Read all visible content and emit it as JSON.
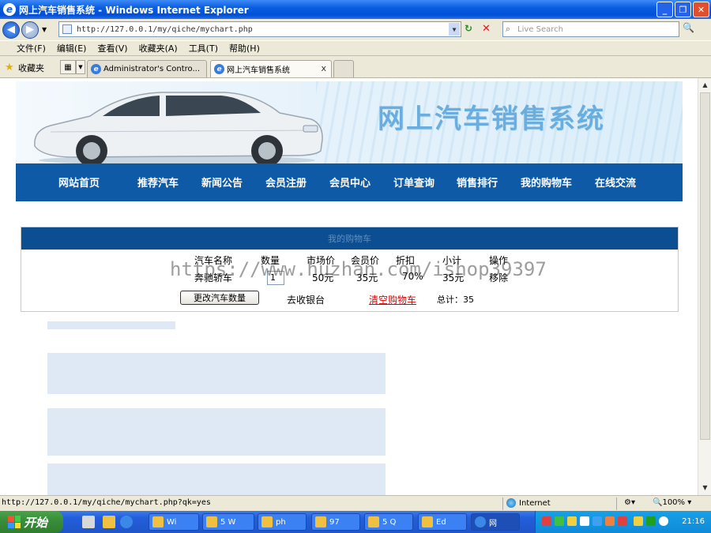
{
  "window": {
    "title": "网上汽车销售系统 - Windows Internet Explorer",
    "minimize": "_",
    "maximize": "❐",
    "close": "✕"
  },
  "addressbar": {
    "url": "http://127.0.0.1/my/qiche/mychart.php",
    "search_placeholder": "Live Search"
  },
  "menu": [
    "文件(F)",
    "编辑(E)",
    "查看(V)",
    "收藏夹(A)",
    "工具(T)",
    "帮助(H)"
  ],
  "favbar": {
    "favorites_label": "收藏夹",
    "tabs": [
      {
        "label": "Administrator's Contro..."
      },
      {
        "label": "网上汽车销售系统",
        "close": "x"
      }
    ]
  },
  "site": {
    "banner_title": "网上汽车销售系统",
    "nav": [
      "网站首页",
      "推荐汽车",
      "新闻公告",
      "会员注册",
      "会员中心",
      "订单查询",
      "销售排行",
      "我的购物车",
      "在线交流"
    ],
    "cart": {
      "header": "我的购物车",
      "columns": [
        "汽车名称",
        "数量",
        "市场价",
        "会员价",
        "折扣",
        "小计",
        "操作"
      ],
      "rows": [
        {
          "name": "奔驰轿车",
          "qty": "1",
          "market_price": "50元",
          "member_price": "35元",
          "discount": "70%",
          "subtotal": "35元",
          "action": "移除"
        }
      ],
      "update_button": "更改汽车数量",
      "checkout_link": "去收银台",
      "clear_link": "清空购物车",
      "total": "总计：35"
    }
  },
  "watermark": "https://www.huzhan.com/ishop39397",
  "statusbar": {
    "url": "http://127.0.0.1/my/qiche/mychart.php?qk=yes",
    "zone": "Internet",
    "zoom": "100%"
  },
  "taskbar": {
    "start": "开始",
    "buttons": [
      "Wi",
      "5 W",
      "ph",
      "97",
      "5 Q",
      "Ed",
      "网"
    ],
    "clock": "21:16"
  },
  "colors": {
    "nav_bg": "#0e5aa6",
    "cart_header_bg": "#0c4e92",
    "clear_link": "#dd0000",
    "banner_title": "#6aaee0"
  }
}
